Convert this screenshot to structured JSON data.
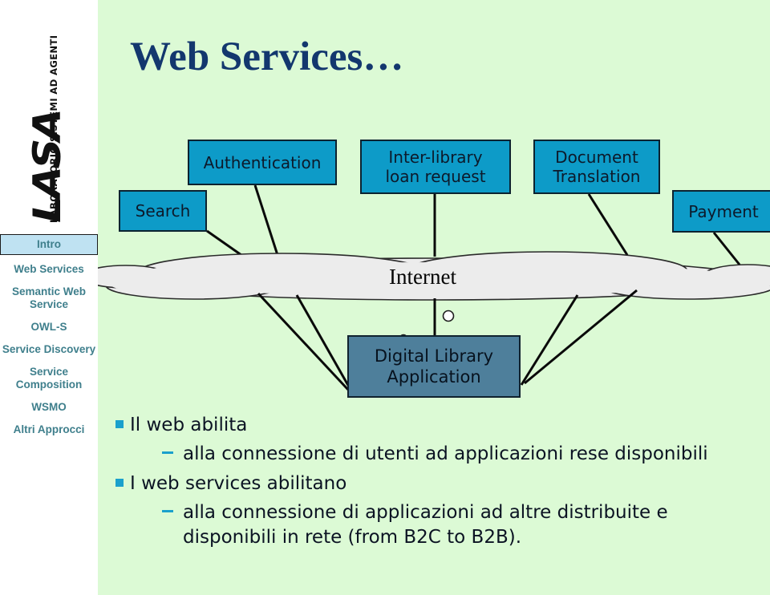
{
  "logo": {
    "mark": "LASA",
    "subtitle": "LABORATORIO SISTEMI AD AGENTI"
  },
  "sidebar": {
    "items": [
      {
        "label": "Intro",
        "active": true
      },
      {
        "label": "Web Services",
        "active": false
      },
      {
        "label": "Semantic Web Service",
        "active": false
      },
      {
        "label": "OWL-S",
        "active": false
      },
      {
        "label": "Service Discovery",
        "active": false
      },
      {
        "label": "Service Composition",
        "active": false
      },
      {
        "label": "WSMO",
        "active": false
      },
      {
        "label": "Altri Approcci",
        "active": false
      }
    ]
  },
  "slide": {
    "title": "Web Services…",
    "background_color": "#dcfad5",
    "title_color": "#13376e"
  },
  "diagram": {
    "service_box_color": "#0d9bc8",
    "app_box_color": "#4e7f9b",
    "cloud_color": "#ececec",
    "boxes": {
      "search": "Search",
      "authentication": "Authentication",
      "interlibrary_line1": "Inter-library",
      "interlibrary_line2": "loan request",
      "document_line1": "Document",
      "document_line2": "Translation",
      "payment": "Payment",
      "application_line1": "Digital Library",
      "application_line2": "Application"
    },
    "cloud_label": "Internet"
  },
  "bullets": {
    "item1": "Il web abilita",
    "sub1": "alla connessione di utenti ad applicazioni rese disponibili",
    "item2": "I web services abilitano",
    "sub2": "alla connessione di applicazioni ad altre distribuite e disponibili in rete (from B2C to B2B).",
    "bullet_color": "#1aa0cc"
  }
}
